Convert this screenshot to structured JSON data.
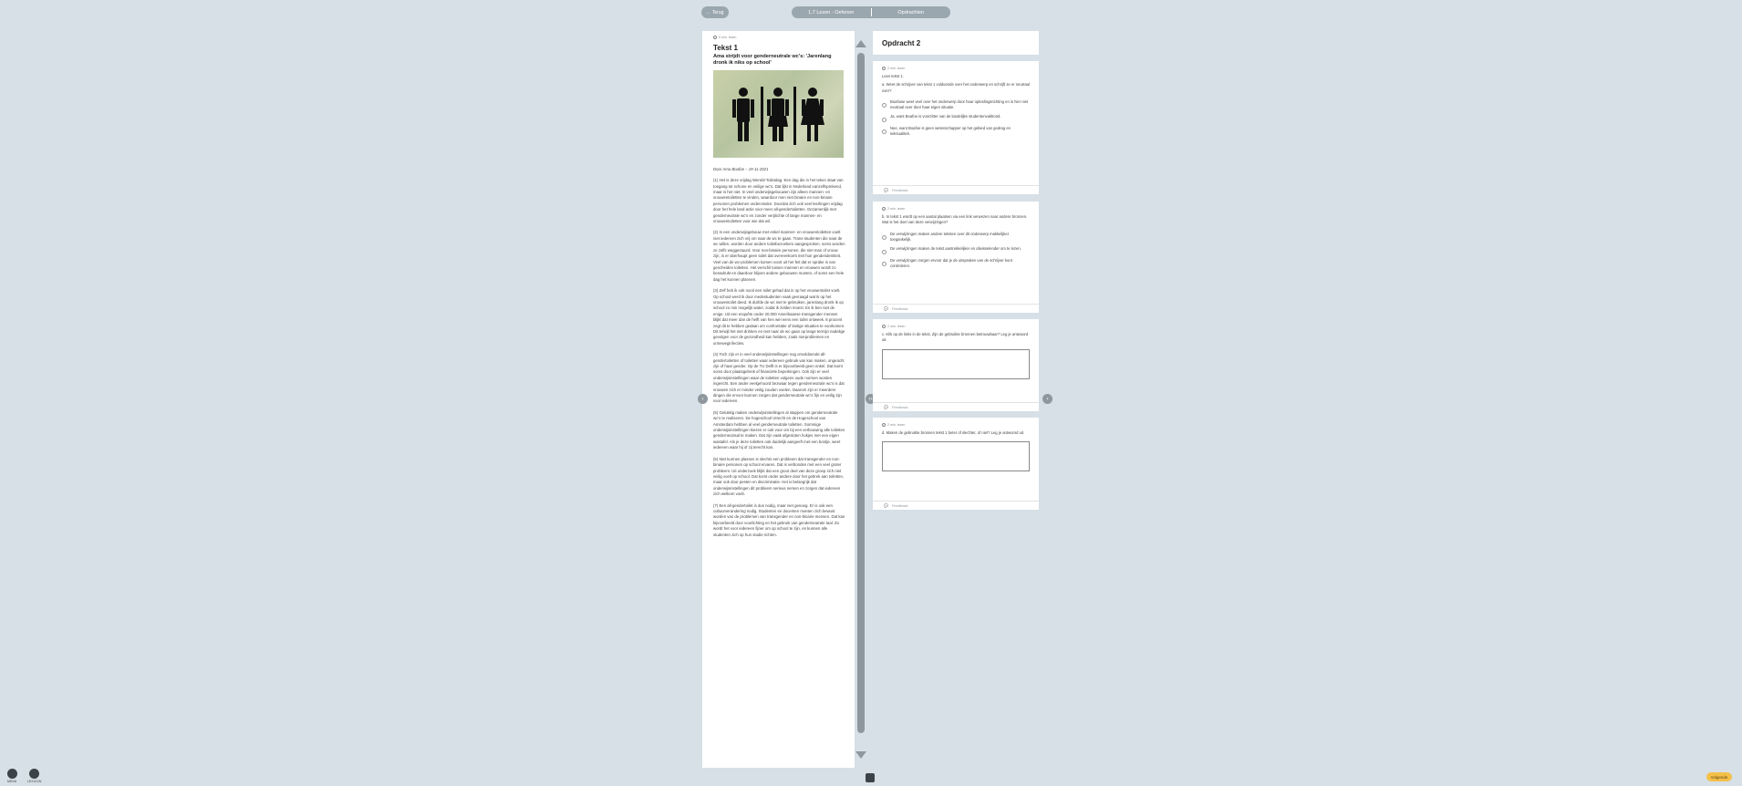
{
  "nav": {
    "back_label": "← Terug",
    "lesson_title": "1.7 Lezen - Oefenen",
    "assignments_label": "Opdrachten"
  },
  "text_panel": {
    "time": "5 min. lezen",
    "title": "Tekst 1",
    "subtitle": "Ama strijdt voor genderneutrale wc's: 'Jarenlang dronk ik niks op school'",
    "author": "Door Ama Boafoe – 19-11-2021",
    "paragraphs": [
      "(1) Het is deze vrijdag Wereld-Toiletdag. Een dag die in het teken staat van toegang tot schone en veilige wc's. Dat lijkt in Nederland vanzelfsprekend, maar is het niet. In veel onderwijsgebouwen zijn alleen mannen- en vrouwentoiletten te vinden, waardoor men niet binaire en non-binaire personen problemen ondervinden. Doordat zich ook veel leerlingen vrijdag door het hele land actie voor meer all-gendertoiletten. Gezamenlijk met genderneutrale wc's en zonder verplichte of lange mannen- en vrouwentoiletten voor wie dat wil.",
      "(2) In een onderwijsgebouw met enkel mannen- en vrouwentoiletten voelt niet iedereen zich vrij om naar de wc te gaan. Trans-studenten die naar de wc willen, worden door andere toiletbezoekers aangesproken, soms worden ze zelfs weggestuurd. Voor non-binaire personen, die niet man of vrouw zijn, is er überhaupt geen toilet dat overeenkomt met hun genderidentiteit. Veel van de wc-problemen komen voort uit het feit dat er sprake is van gescheiden toiletten. Het verschil tussen mannen en vrouwen wordt zo benadrukt en daardoor blijven andere gebouwen moeten, of soms een hele dag het kunnen plannen.",
      "(3) Zelf heb ik ook nooit een toilet gehad dat in op het vrouwentoilet voelt. Op school werd ik door medestudenten vaak gevraagd wat ik op het vrouwentoilet deed. Ik durfde de wc niet te gebruiken, jarenlang dronk ik op school zo min mogelijk water, zodat ik zelden moest. En ik ben niet de enige. Uit een enquête onder 20.000 Amerikaanse transgender mensen blijkt dat meer dan de helft van hen wel eens een toilet ontweek. 8 procent zegt dit te hebben gedaan om confrontatie of lastige situaties te voorkomen. Dit terwijl het niet drinken en niet naar de wc gaan op lange termijn nadelige gevolgen voor de gezondheid kan hebben, zoals nierproblemen en urineweginfecties.",
      "(4) Toch zijn er in veel onderwijsinstellingen nog onvoldoende all-gendertoiletten of toiletten waar iedereen gebruik van kan maken, ongeacht zijn of haar gender. Op de TU Delft is er bijvoorbeeld geen enkel. Dat komt soms door plaatsgebrek of financiële beperkingen. Ook zijn er veel onderwijsinstellingen waar de toiletten volgens oude normen worden ingericht. Een ander veelgehoord bezwaar tegen genderneutrale wc's is dat vrouwen zich er minder veilig zouden voelen. Daarom zijn er meerdere dingen die ervoor kunnen zorgen dat genderneutrale wc's fijn en veilig zijn voor iedereen.",
      "(5) Gelukkig maken onderwijsinstellingen al stappen om genderneutrale wc's te realiseren. De hogeschool Utrecht en de Hogeschool van Amsterdam hebben al veel genderneutrale toiletten. Sommige onderwijsinstellingen kiezen er ook voor om bij een verbouwing alle toiletten genderneutraal te maken. Dat zijn vaak afgesloten hokjes met een eigen wastafel. Als je deze toiletten ook duidelijk aangeeft met een bordje, weet iedereen waar hij of zij terecht kan.",
      "(6) Niet kunnen plassen is slechts een probleem dat transgender en non-binaire personen op school ervaren. Dat is verbonden met een veel groter probleem. Uit onderzoek blijkt dat een groot deel van deze groep zich niet veilig voelt op school. Dat komt onder andere door het gebrek aan toiletten, maar ook door pesten en discriminatie. Het is belangrijk dat onderwijsinstellingen dit probleem serieus nemen en zorgen dat iedereen zich welkom voelt.",
      "(7) Een all-gendertoilet is dus nodig, maar niet genoeg. Er is ook een cultuurverandering nodig. Studenten en docenten moeten zich bewust worden van de problemen van transgender en non-binaire mensen. Dat kan bijvoorbeeld door voorlichting en het gebruik van genderneutrale taal. Zo wordt het voor iedereen fijner om op school te zijn, en kunnen alle studenten zich op hun studie richten."
    ]
  },
  "right_panel": {
    "title": "Opdracht 2",
    "feedback_label": "Feedback",
    "questions": [
      {
        "time": "2 min. lezen",
        "intro": "Lees tekst 1.",
        "stem": "a. Weet de schrijver van tekst 1 voldoende over het onderwerp en schrijft ze er neutraal over?",
        "options": [
          "Boafowe weet veel over het onderwerp door haar opleidingsrichting en is hier niet neutraal over door haar eigen situatie.",
          "Ja, want Boafoe is voorzitter van de landelijke studentenvakbond.",
          "Nee, want Boafoe is geen wetenschapper op het gebied van gedrag en seksualiteit."
        ]
      },
      {
        "time": "2 min. lezen",
        "intro": "",
        "stem": "b. In tekst 1 wordt op een aantal plaatsen via een link verwezen naar andere bronnen. Wat is het doel van deze verwijzingen?",
        "options": [
          "De verwijzingen maken andere teksten over dit onderwerp makkelijker toegankelijk.",
          "De verwijzingen maken de tekst aantrekkelijker en afwisselender om te lezen.",
          "De verwijzingen zorgen ervoor dat je de uitspraken van de schrijver kunt controleren."
        ]
      },
      {
        "time": "2 min. lezen",
        "intro": "",
        "stem": "c. Klik op de links in de tekst. Zijn de gebruikte bronnen betrouwbaar? Leg je antwoord uit.",
        "options": []
      },
      {
        "time": "2 min. lezen",
        "intro": "",
        "stem": "d. Maken de gebruikte bronnen tekst 1 beter of slechter, of niet? Leg je antwoord uit.",
        "options": []
      }
    ]
  },
  "bottom": {
    "menu_label": "MENU",
    "lexicon_label": "LEXICON",
    "next_label": "Volgende"
  }
}
